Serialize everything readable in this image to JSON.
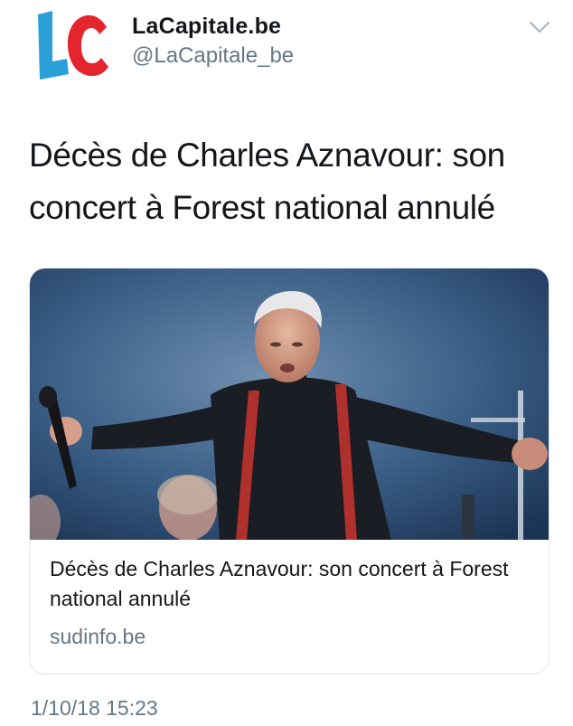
{
  "header": {
    "display_name": "LaCapitale.be",
    "handle": "@LaCapitale_be",
    "avatar_icon": "lacapitale-logo",
    "menu_icon": "chevron-down-icon"
  },
  "tweet": {
    "text": "Décès de Charles Aznavour: son concert à Forest national annulé",
    "timestamp": "1/10/18 15:23"
  },
  "card": {
    "image_icon": "concert-photo",
    "title": "Décès de Charles Aznavour: son concert à Forest national annulé",
    "domain": "sudinfo.be"
  },
  "colors": {
    "logo_blue": "#2a9fd8",
    "logo_red": "#e3262d",
    "secondary_text": "#657786",
    "border": "#e1e8ed"
  }
}
